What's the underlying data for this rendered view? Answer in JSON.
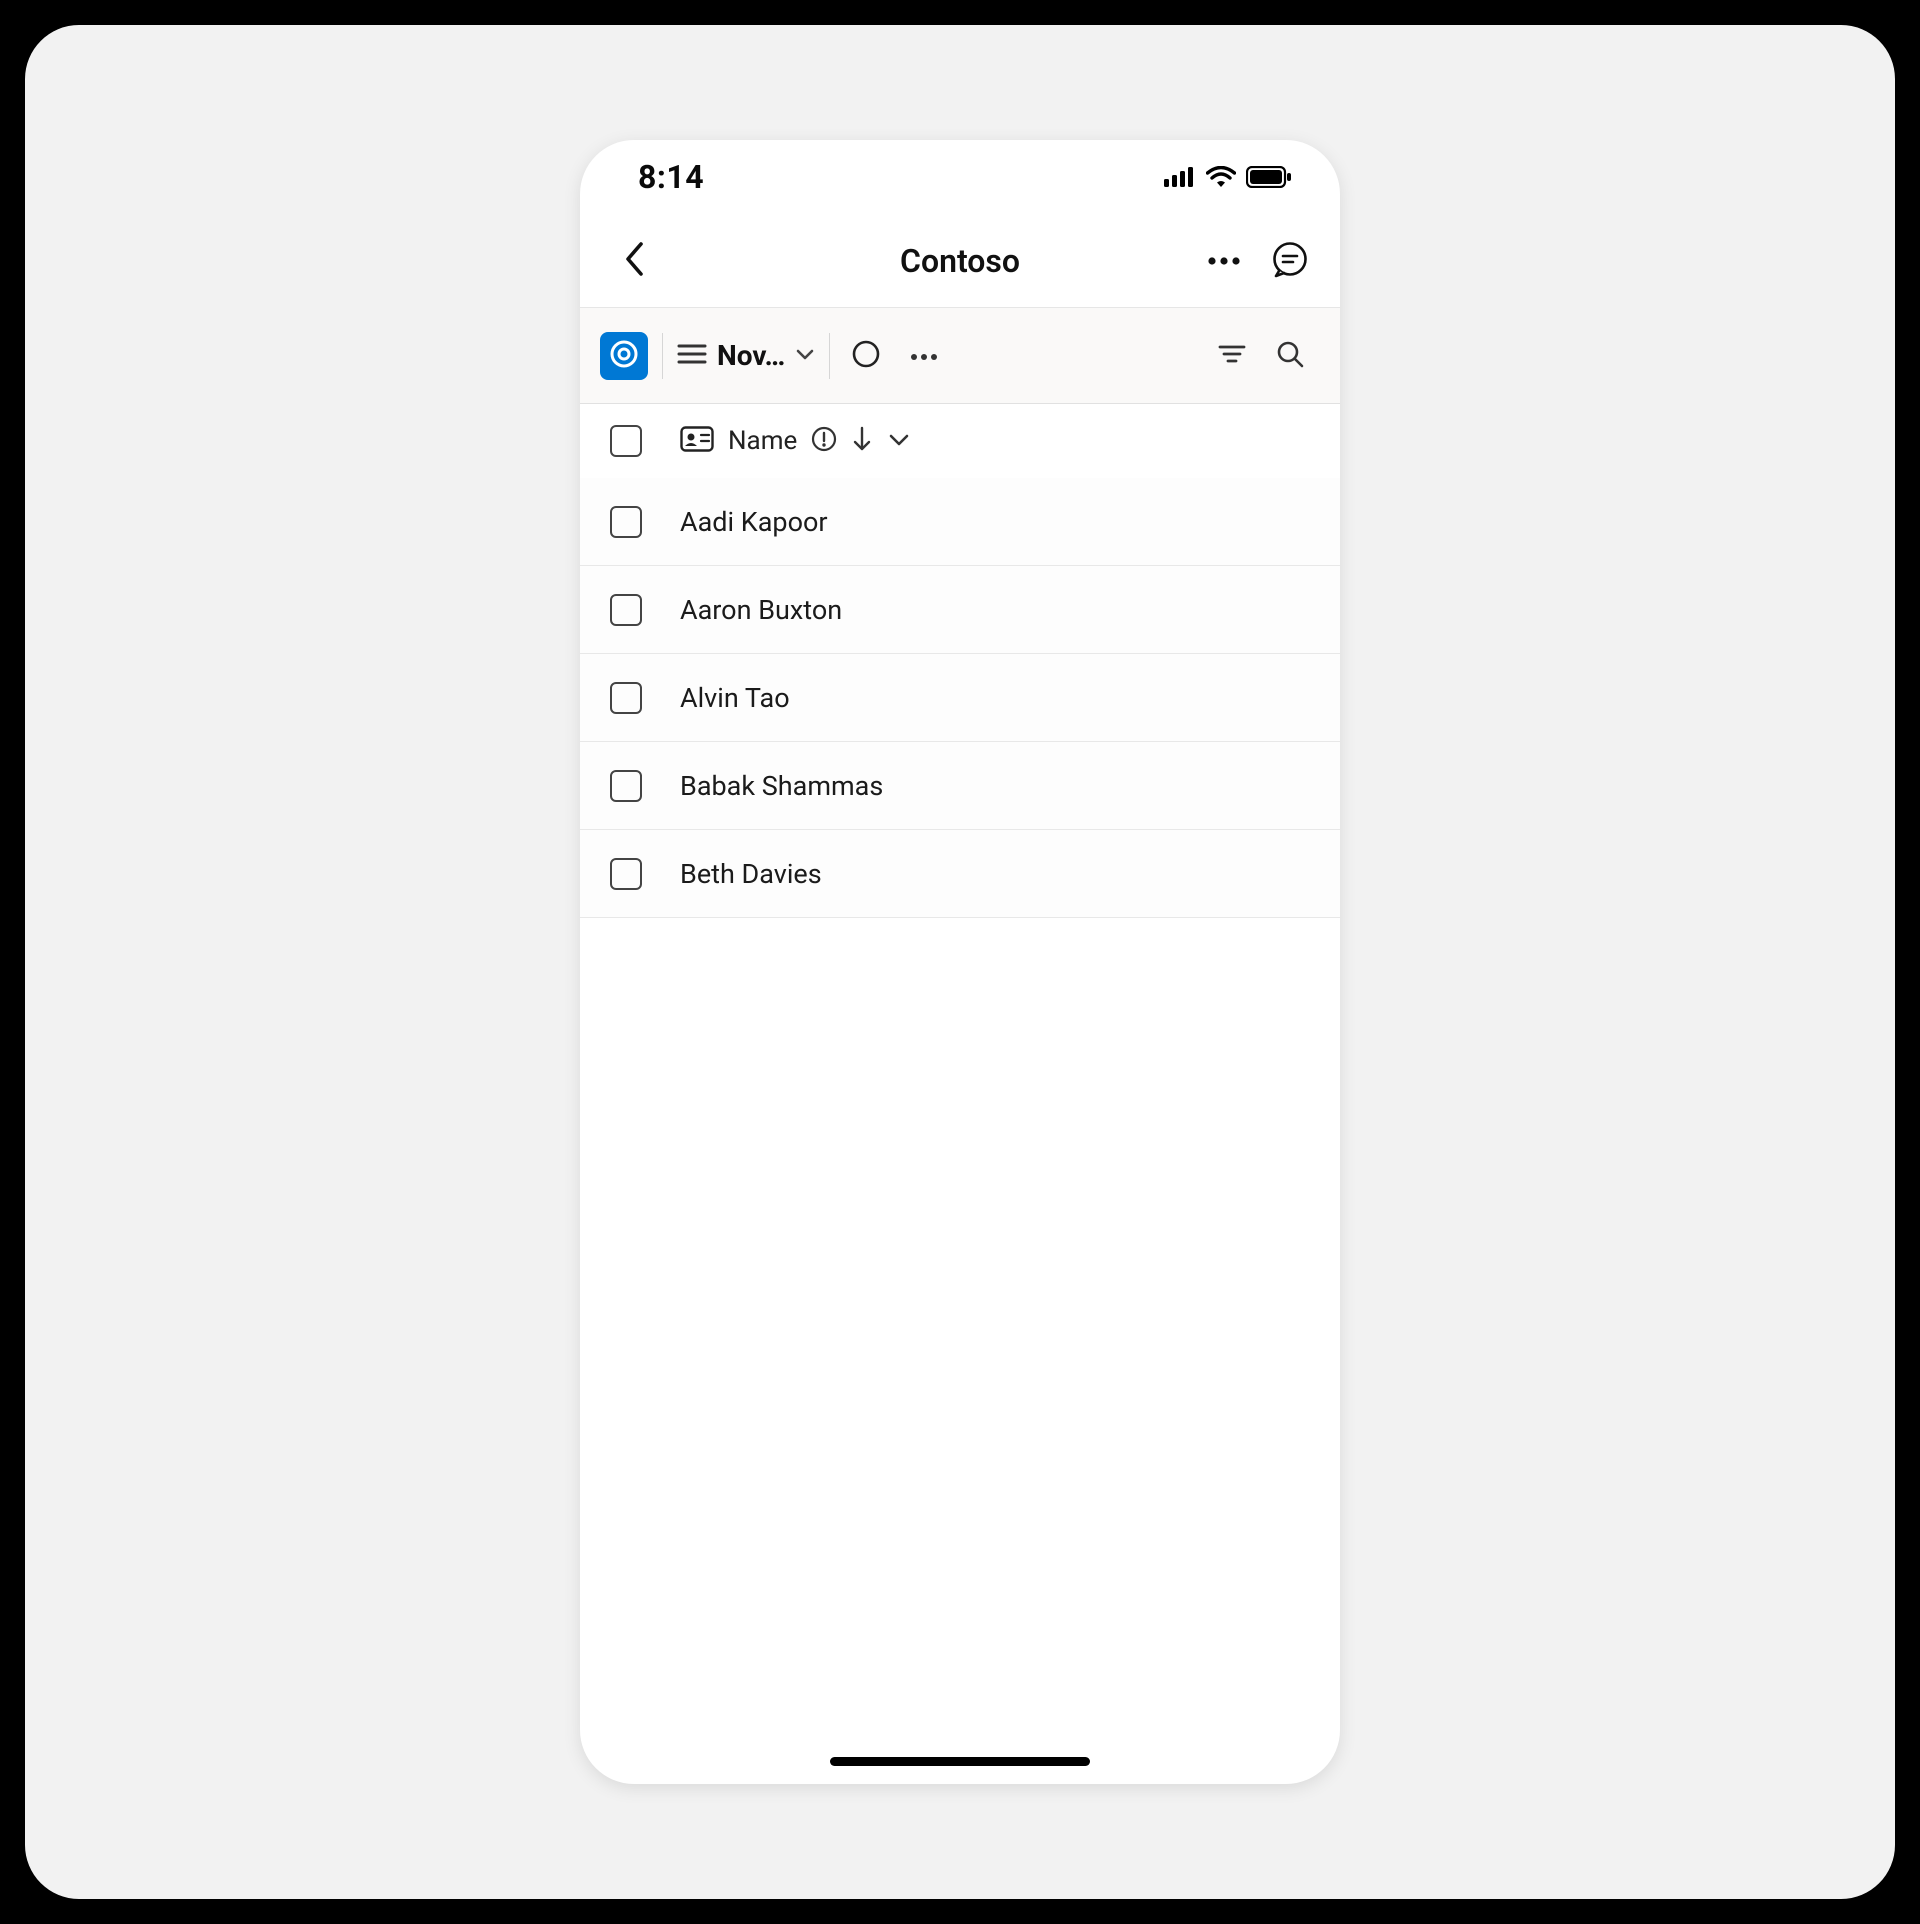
{
  "statusbar": {
    "time": "8:14"
  },
  "header": {
    "title": "Contoso"
  },
  "toolbar": {
    "view_label": "Nov…"
  },
  "columns": {
    "name_label": "Name"
  },
  "rows": [
    {
      "name": "Aadi Kapoor"
    },
    {
      "name": "Aaron Buxton"
    },
    {
      "name": "Alvin Tao"
    },
    {
      "name": "Babak Shammas"
    },
    {
      "name": "Beth Davies"
    }
  ]
}
